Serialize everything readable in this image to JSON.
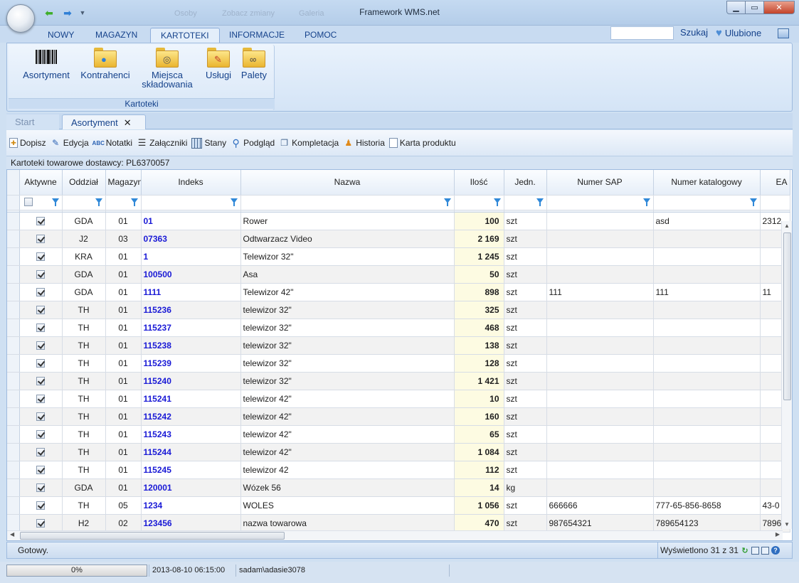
{
  "window": {
    "title": "Framework WMS.net",
    "faded_items": [
      "Osoby",
      "Zobacz zmiany",
      "Galeria"
    ]
  },
  "ribbon_tabs": [
    "NOWY",
    "MAGAZYN",
    "KARTOTEKI",
    "INFORMACJE",
    "POMOC"
  ],
  "active_ribbon_tab": "KARTOTEKI",
  "search": {
    "label": "Szukaj",
    "placeholder": ""
  },
  "favorites_label": "Ulubione",
  "ribbon_group": {
    "label": "Kartoteki",
    "buttons": [
      {
        "label": "Asortyment",
        "icon": "barcode-icon"
      },
      {
        "label": "Kontrahenci",
        "icon": "folder-people-icon"
      },
      {
        "label": "Miejsca składowania",
        "line1": "Miejsca",
        "line2": "składowania",
        "icon": "folder-database-icon"
      },
      {
        "label": "Usługi",
        "icon": "folder-pencil-icon"
      },
      {
        "label": "Palety",
        "icon": "folder-binoculars-icon"
      }
    ]
  },
  "doc_tabs": {
    "start": "Start",
    "active": "Asortyment"
  },
  "toolbar": [
    {
      "label": "Dopisz",
      "icon": "add-document-icon"
    },
    {
      "label": "Edycja",
      "icon": "edit-icon"
    },
    {
      "label": "Notatki",
      "icon": "spellcheck-icon"
    },
    {
      "label": "Załączniki",
      "icon": "list-icon"
    },
    {
      "label": "Stany",
      "icon": "grid-icon"
    },
    {
      "label": "Podgląd",
      "icon": "magnifier-icon"
    },
    {
      "label": "Kompletacja",
      "icon": "copy-icon"
    },
    {
      "label": "Historia",
      "icon": "people-icon"
    },
    {
      "label": "Karta produktu",
      "icon": "document-icon"
    }
  ],
  "info_bar": "Kartoteki towarowe dostawcy: PL6370057",
  "grid": {
    "columns": [
      "Aktywne",
      "Oddział",
      "Magazyn",
      "Indeks",
      "Nazwa",
      "Ilość",
      "Jedn.",
      "Numer SAP",
      "Numer katalogowy",
      "EAN"
    ],
    "columns_visible": [
      "Aktywne",
      "Oddział",
      "Magazyn",
      "Indeks",
      "Nazwa",
      "Ilość",
      "Jedn.",
      "Numer SAP",
      "Numer katalogowy",
      "EA"
    ],
    "rows": [
      {
        "active": true,
        "branch": "GDA",
        "warehouse": "01",
        "index": "01",
        "name": "Rower",
        "qty": "100",
        "unit": "szt",
        "sap": "",
        "catalog": "asd",
        "ean": "2312"
      },
      {
        "active": true,
        "branch": "J2",
        "warehouse": "03",
        "index": "07363",
        "name": "Odtwarzacz Video",
        "qty": "2 169",
        "unit": "szt",
        "sap": "",
        "catalog": "",
        "ean": ""
      },
      {
        "active": true,
        "branch": "KRA",
        "warehouse": "01",
        "index": "1",
        "name": "Telewizor 32\"",
        "qty": "1 245",
        "unit": "szt",
        "sap": "",
        "catalog": "",
        "ean": ""
      },
      {
        "active": true,
        "branch": "GDA",
        "warehouse": "01",
        "index": "100500",
        "name": "Asa",
        "qty": "50",
        "unit": "szt",
        "sap": "",
        "catalog": "",
        "ean": ""
      },
      {
        "active": true,
        "branch": "GDA",
        "warehouse": "01",
        "index": "1111",
        "name": "Telewizor 42\"",
        "qty": "898",
        "unit": "szt",
        "sap": "111",
        "catalog": "111",
        "ean": "11"
      },
      {
        "active": true,
        "branch": "TH",
        "warehouse": "01",
        "index": "115236",
        "name": "telewizor 32\"",
        "qty": "325",
        "unit": "szt",
        "sap": "",
        "catalog": "",
        "ean": ""
      },
      {
        "active": true,
        "branch": "TH",
        "warehouse": "01",
        "index": "115237",
        "name": "telewizor 32\"",
        "qty": "468",
        "unit": "szt",
        "sap": "",
        "catalog": "",
        "ean": ""
      },
      {
        "active": true,
        "branch": "TH",
        "warehouse": "01",
        "index": "115238",
        "name": "telewizor 32\"",
        "qty": "138",
        "unit": "szt",
        "sap": "",
        "catalog": "",
        "ean": ""
      },
      {
        "active": true,
        "branch": "TH",
        "warehouse": "01",
        "index": "115239",
        "name": "telewizor 32\"",
        "qty": "128",
        "unit": "szt",
        "sap": "",
        "catalog": "",
        "ean": ""
      },
      {
        "active": true,
        "branch": "TH",
        "warehouse": "01",
        "index": "115240",
        "name": "telewizor 32\"",
        "qty": "1 421",
        "unit": "szt",
        "sap": "",
        "catalog": "",
        "ean": ""
      },
      {
        "active": true,
        "branch": "TH",
        "warehouse": "01",
        "index": "115241",
        "name": "telewizor 42\"",
        "qty": "10",
        "unit": "szt",
        "sap": "",
        "catalog": "",
        "ean": ""
      },
      {
        "active": true,
        "branch": "TH",
        "warehouse": "01",
        "index": "115242",
        "name": "telewizor 42\"",
        "qty": "160",
        "unit": "szt",
        "sap": "",
        "catalog": "",
        "ean": ""
      },
      {
        "active": true,
        "branch": "TH",
        "warehouse": "01",
        "index": "115243",
        "name": "telewizor 42\"",
        "qty": "65",
        "unit": "szt",
        "sap": "",
        "catalog": "",
        "ean": ""
      },
      {
        "active": true,
        "branch": "TH",
        "warehouse": "01",
        "index": "115244",
        "name": "telewizor 42\"",
        "qty": "1 084",
        "unit": "szt",
        "sap": "",
        "catalog": "",
        "ean": ""
      },
      {
        "active": true,
        "branch": "TH",
        "warehouse": "01",
        "index": "115245",
        "name": "telewizor 42",
        "qty": "112",
        "unit": "szt",
        "sap": "",
        "catalog": "",
        "ean": ""
      },
      {
        "active": true,
        "branch": "GDA",
        "warehouse": "01",
        "index": "120001",
        "name": "Wózek 56",
        "qty": "14",
        "unit": "kg",
        "sap": "",
        "catalog": "",
        "ean": ""
      },
      {
        "active": true,
        "branch": "TH",
        "warehouse": "05",
        "index": "1234",
        "name": "WOLES",
        "qty": "1 056",
        "unit": "szt",
        "sap": "666666",
        "catalog": "777-65-856-8658",
        "ean": "43-0"
      },
      {
        "active": true,
        "branch": "H2",
        "warehouse": "02",
        "index": "123456",
        "name": "nazwa towarowa",
        "qty": "470",
        "unit": "szt",
        "sap": "987654321",
        "catalog": "789654123",
        "ean": "7896"
      }
    ]
  },
  "status": {
    "left": "Gotowy.",
    "right": "Wyświetlono 31 z 31"
  },
  "bottom": {
    "progress": "0%",
    "progress_value": 0,
    "datetime": "2013-08-10 06:15:00",
    "user": "sadam\\adasie3078"
  },
  "colors": {
    "accent_text": "#15428b",
    "index_link": "#1a1ad6",
    "qty_highlight": "#fdfbe2",
    "filter_icon": "#2f88d8"
  }
}
